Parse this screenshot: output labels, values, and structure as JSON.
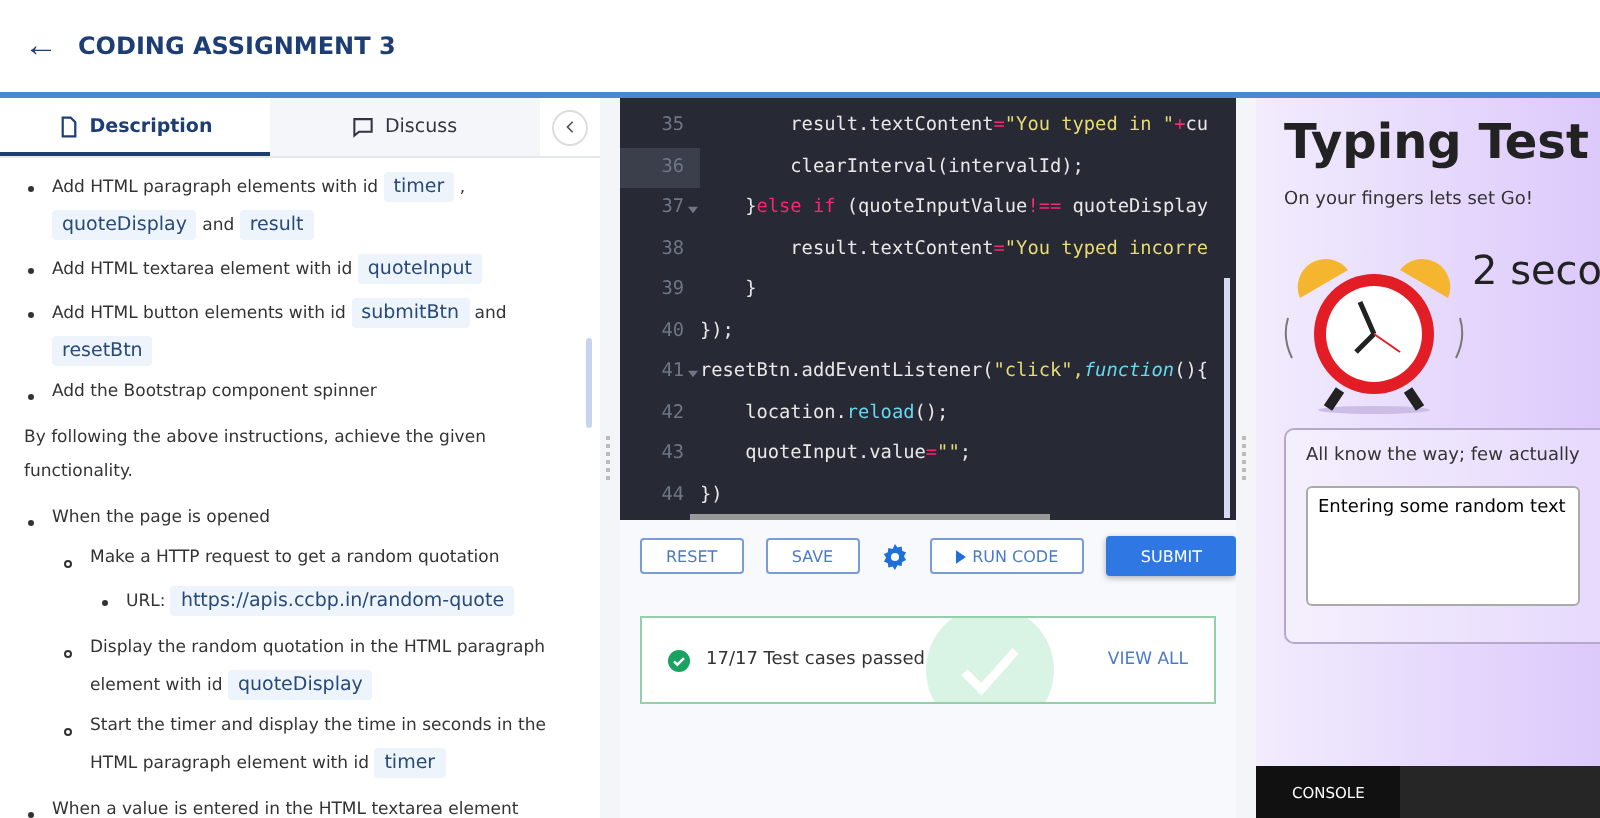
{
  "header": {
    "back_icon": "←",
    "title": "CODING ASSIGNMENT 3"
  },
  "tabs": [
    {
      "label": "Description",
      "selected": true
    },
    {
      "label": "Discuss",
      "selected": false
    }
  ],
  "description": {
    "items": [
      {
        "kind": "bullet",
        "parts": [
          {
            "t": "Add HTML paragraph elements with id "
          },
          {
            "code": "timer"
          },
          {
            "t": " , "
          },
          {
            "code": "quoteDisplay"
          },
          {
            "t": " and "
          },
          {
            "code": "result"
          }
        ]
      },
      {
        "kind": "bullet",
        "parts": [
          {
            "t": "Add HTML textarea element with id "
          },
          {
            "code": "quoteInput"
          }
        ]
      },
      {
        "kind": "bullet",
        "parts": [
          {
            "t": "Add HTML button elements with id "
          },
          {
            "code": "submitBtn"
          },
          {
            "t": " and "
          },
          {
            "code": "resetBtn"
          }
        ]
      },
      {
        "kind": "bullet",
        "parts": [
          {
            "t": "Add the Bootstrap component spinner"
          }
        ]
      },
      {
        "kind": "paragraph",
        "parts": [
          {
            "t": "By following the above instructions, achieve the given functionality."
          }
        ]
      },
      {
        "kind": "bullet",
        "parts": [
          {
            "t": "When the page is opened"
          }
        ],
        "children": [
          {
            "kind": "circle",
            "parts": [
              {
                "t": "Make a HTTP request to get a random quotation"
              }
            ],
            "children": [
              {
                "kind": "bullet",
                "parts": [
                  {
                    "t": "URL: "
                  },
                  {
                    "code": "https://apis.ccbp.in/random-quote"
                  }
                ]
              }
            ]
          },
          {
            "kind": "circle",
            "parts": [
              {
                "t": "Display the random quotation in the HTML paragraph element with id "
              },
              {
                "code": "quoteDisplay"
              }
            ]
          },
          {
            "kind": "circle",
            "parts": [
              {
                "t": "Start the timer and display the time in seconds in the HTML paragraph element with id "
              },
              {
                "code": "timer"
              }
            ]
          }
        ]
      },
      {
        "kind": "bullet",
        "parts": [
          {
            "t": "When a value is entered in the HTML textarea element"
          }
        ]
      }
    ]
  },
  "editor": {
    "lines": [
      {
        "num": "35",
        "fold": false,
        "active": false,
        "tokens": [
          {
            "t": "        result.textContent",
            "color": "#e8e8e8"
          },
          {
            "t": "=",
            "color": "#f92672"
          },
          {
            "t": "\"You typed in \"",
            "color": "#e6db74"
          },
          {
            "t": "+",
            "color": "#f92672"
          },
          {
            "t": "cu",
            "color": "#e8e8e8"
          }
        ]
      },
      {
        "num": "36",
        "fold": false,
        "active": true,
        "tokens": [
          {
            "t": "        clearInterval(intervalId);",
            "color": "#e8e8e8"
          }
        ]
      },
      {
        "num": "37",
        "fold": true,
        "active": false,
        "tokens": [
          {
            "t": "    }",
            "color": "#e8e8e8"
          },
          {
            "t": "else if",
            "color": "#f92672"
          },
          {
            "t": " (quoteInputValue",
            "color": "#e8e8e8"
          },
          {
            "t": "!==",
            "color": "#f92672"
          },
          {
            "t": " quoteDisplay",
            "color": "#e8e8e8"
          }
        ]
      },
      {
        "num": "38",
        "fold": false,
        "active": false,
        "tokens": [
          {
            "t": "        result.textContent",
            "color": "#e8e8e8"
          },
          {
            "t": "=",
            "color": "#f92672"
          },
          {
            "t": "\"You typed incorre",
            "color": "#e6db74"
          }
        ]
      },
      {
        "num": "39",
        "fold": false,
        "active": false,
        "tokens": [
          {
            "t": "    }",
            "color": "#e8e8e8"
          }
        ]
      },
      {
        "num": "40",
        "fold": false,
        "active": false,
        "tokens": [
          {
            "t": "});",
            "color": "#e8e8e8"
          }
        ]
      },
      {
        "num": "41",
        "fold": true,
        "active": false,
        "tokens": [
          {
            "t": "resetBtn.addEventListener(",
            "color": "#e8e8e8"
          },
          {
            "t": "\"click\",",
            "color": "#e6db74"
          },
          {
            "t": "function",
            "color": "#66d9ef",
            "italic": true
          },
          {
            "t": "(){",
            "color": "#e8e8e8"
          }
        ]
      },
      {
        "num": "42",
        "fold": false,
        "active": false,
        "tokens": [
          {
            "t": "    location.",
            "color": "#e8e8e8"
          },
          {
            "t": "reload",
            "color": "#66d9ef"
          },
          {
            "t": "();",
            "color": "#e8e8e8"
          }
        ]
      },
      {
        "num": "43",
        "fold": false,
        "active": false,
        "tokens": [
          {
            "t": "    quoteInput.value",
            "color": "#e8e8e8"
          },
          {
            "t": "=",
            "color": "#f92672"
          },
          {
            "t": "\"\"",
            "color": "#e6db74"
          },
          {
            "t": ";",
            "color": "#e8e8e8"
          }
        ]
      },
      {
        "num": "44",
        "fold": false,
        "active": false,
        "tokens": [
          {
            "t": "})",
            "color": "#e8e8e8"
          }
        ]
      }
    ]
  },
  "actions": [
    {
      "label": "RESET",
      "kind": "outline"
    },
    {
      "label": "SAVE",
      "kind": "outline"
    },
    {
      "kind": "settings"
    },
    {
      "label": "RUN CODE",
      "kind": "run"
    },
    {
      "label": "SUBMIT",
      "kind": "primary"
    }
  ],
  "result": {
    "text": "17/17 Test cases passed",
    "link": "VIEW ALL",
    "passed": true
  },
  "preview": {
    "title": "Typing Test",
    "subtitle": "On your fingers lets set Go!",
    "timer": "2 seco",
    "quote": "All know the way; few actually",
    "input_value": "Entering some random text"
  },
  "console": {
    "tab": "CONSOLE"
  }
}
